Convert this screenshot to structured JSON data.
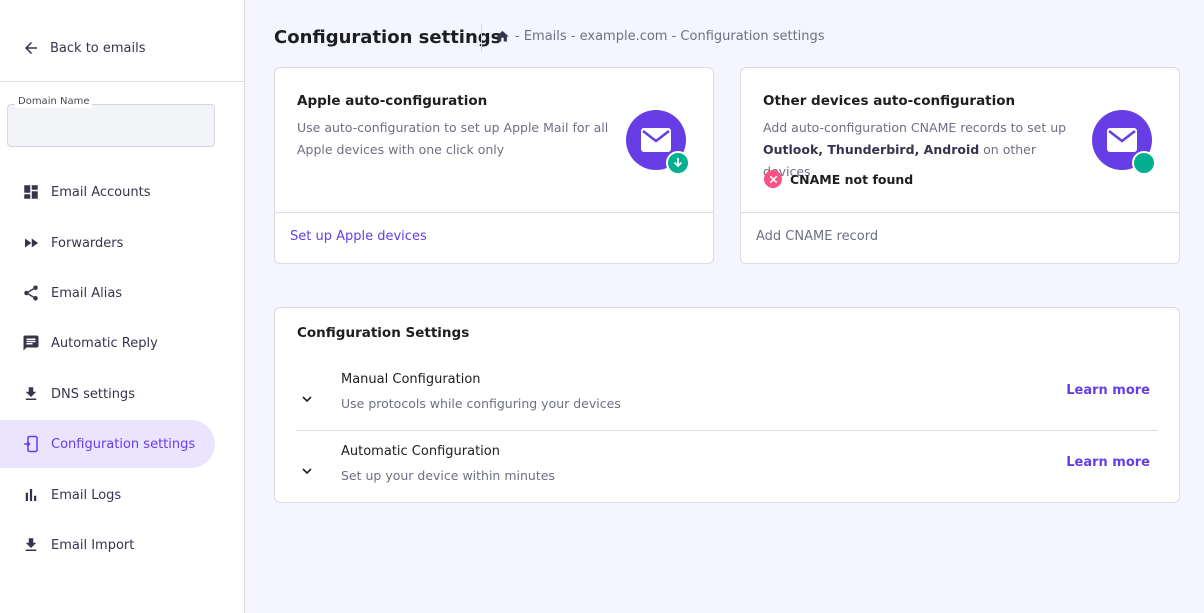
{
  "sidebar": {
    "back_label": "Back to emails",
    "domain_field": {
      "label": "Domain Name",
      "value": ""
    },
    "items": [
      {
        "label": "Email Accounts",
        "icon": "dashboard-icon",
        "active": false
      },
      {
        "label": "Forwarders",
        "icon": "fast-forward-icon",
        "active": false
      },
      {
        "label": "Email Alias",
        "icon": "share-icon",
        "active": false
      },
      {
        "label": "Automatic Reply",
        "icon": "message-icon",
        "active": false
      },
      {
        "label": "DNS settings",
        "icon": "download-icon",
        "active": false
      },
      {
        "label": "Configuration settings",
        "icon": "device-sync-icon",
        "active": true
      },
      {
        "label": "Email Logs",
        "icon": "bar-chart-icon",
        "active": false
      },
      {
        "label": "Email Import",
        "icon": "download-icon",
        "active": false
      }
    ]
  },
  "header": {
    "title": "Configuration settings",
    "breadcrumb": "- Emails  - example.com - Configuration settings"
  },
  "apple_card": {
    "title": "Apple auto-configuration",
    "desc_line1": "Use auto-configuration to set up Apple Mail for all",
    "desc_line2": "Apple devices with one click only",
    "link": "Set up Apple devices"
  },
  "other_card": {
    "title": "Other devices auto-configuration",
    "desc_line1": "Add auto-configuration CNAME records to set up",
    "desc_b1": "Outlook",
    "desc_sep1": ", ",
    "desc_b2": "Thunderbird",
    "desc_sep2": ", ",
    "desc_b3": "Android",
    "desc_tail": " on other devices",
    "status": "CNAME not found",
    "link": "Add CNAME record"
  },
  "config": {
    "title": "Configuration Settings",
    "rows": [
      {
        "title": "Manual Configuration",
        "desc": "Use protocols while configuring your devices",
        "link": "Learn more"
      },
      {
        "title": "Automatic Configuration",
        "desc": "Set up your device within minutes",
        "link": "Learn more"
      }
    ]
  },
  "colors": {
    "accent": "#673de6",
    "success": "#00b090",
    "error": "#fc5185",
    "highlight": "#e00000"
  }
}
